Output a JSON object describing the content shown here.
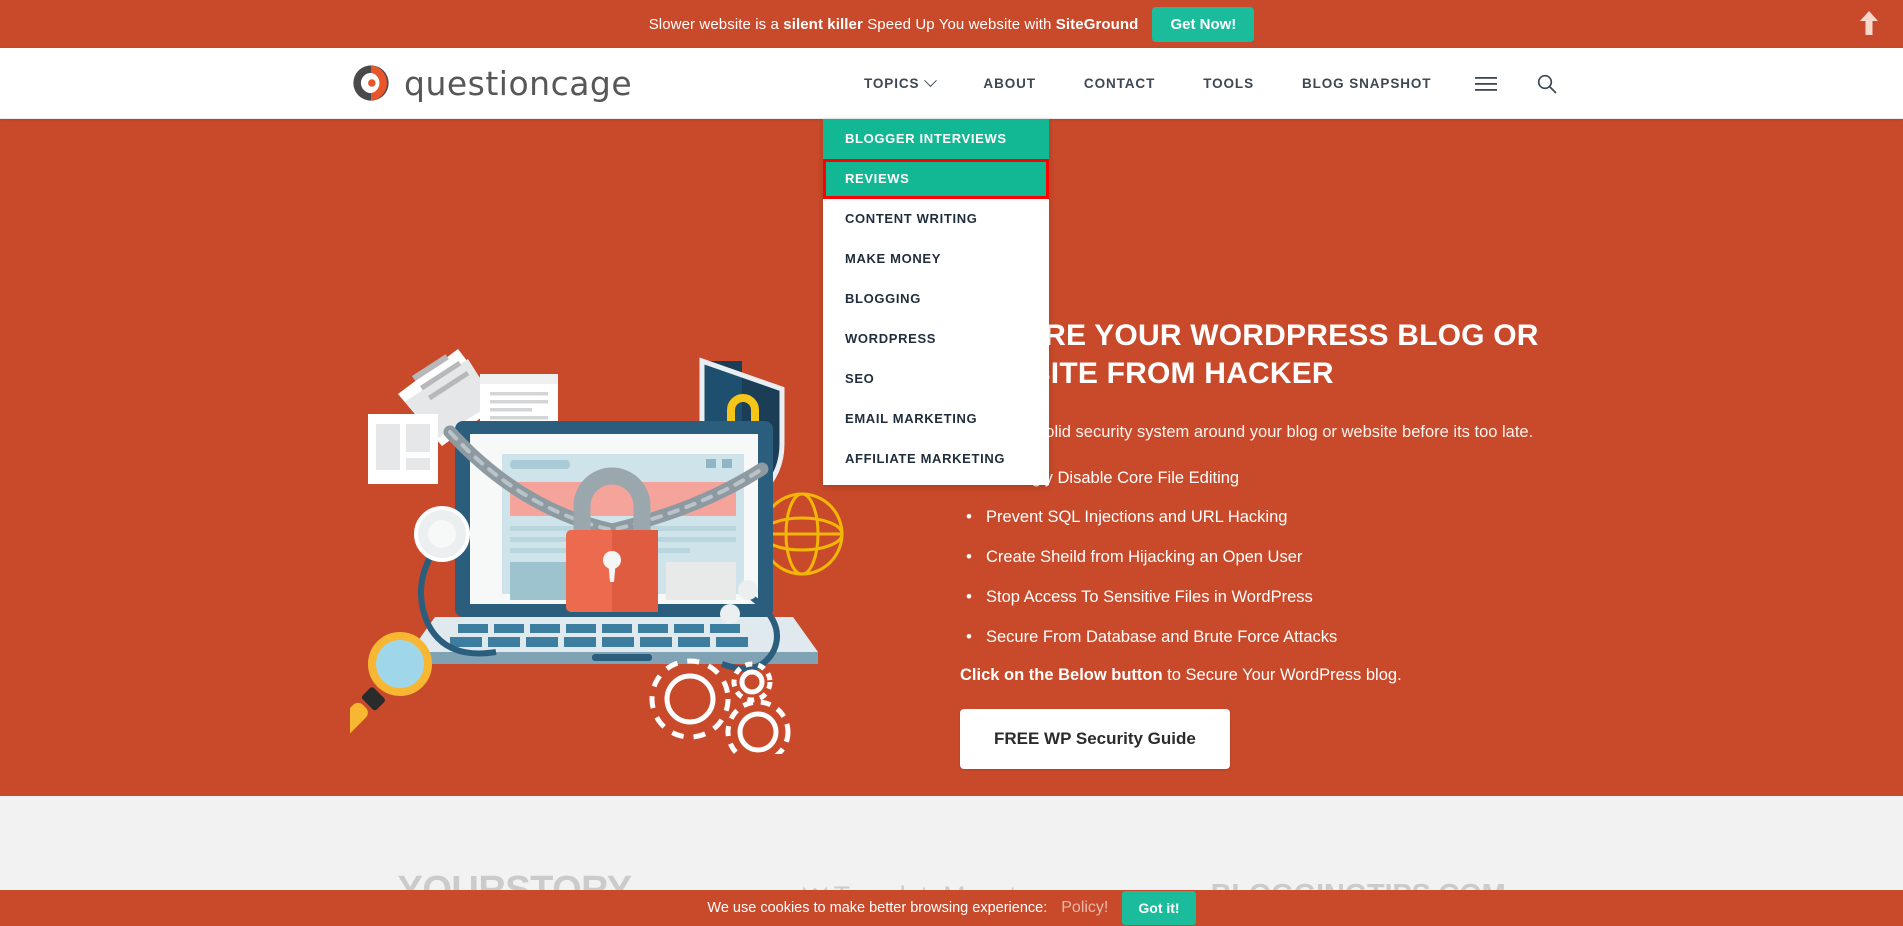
{
  "colors": {
    "brand_orange": "#c94a2a",
    "teal": "#1abc9c",
    "dropdown_active": "#12b794",
    "highlight_red": "#ff0000",
    "partner_gray": "#cbcbcb"
  },
  "promo": {
    "text_before": "Slower website is a ",
    "bold_1": "silent killer",
    "text_middle": " Speed Up You website with ",
    "bold_2": "SiteGround",
    "button_label": "Get Now!",
    "scroll_top_icon": "arrow-up-icon"
  },
  "header": {
    "logo_text": "questioncage",
    "logo_icon": "circle-logo-icon",
    "nav": [
      {
        "label": "TOPICS",
        "has_caret": true
      },
      {
        "label": "ABOUT",
        "has_caret": false
      },
      {
        "label": "CONTACT",
        "has_caret": false
      },
      {
        "label": "TOOLS",
        "has_caret": false
      },
      {
        "label": "BLOG SNAPSHOT",
        "has_caret": false
      }
    ],
    "hamburger_icon": "hamburger-menu-icon",
    "search_icon": "search-icon"
  },
  "dropdown": {
    "items": [
      {
        "label": "BLOGGER INTERVIEWS",
        "state": "active"
      },
      {
        "label": "REVIEWS",
        "state": "highlight"
      },
      {
        "label": "CONTENT WRITING",
        "state": "normal"
      },
      {
        "label": "MAKE MONEY",
        "state": "normal"
      },
      {
        "label": "BLOGGING",
        "state": "normal"
      },
      {
        "label": "WORDPRESS",
        "state": "normal"
      },
      {
        "label": "SEO",
        "state": "normal"
      },
      {
        "label": "EMAIL MARKETING",
        "state": "normal"
      },
      {
        "label": "AFFILIATE MARKETING",
        "state": "normal"
      }
    ]
  },
  "hero": {
    "title": "SECURE YOUR WORDPRESS BLOG OR WEBSITE FROM HACKER",
    "subtitle": "Build rock solid security system around your blog or website before its too late.",
    "bullets": [
      "Strikingly Disable Core File Editing",
      "Prevent SQL Injections and URL Hacking",
      "Create Sheild from Hijacking an Open User",
      "Stop Access To Sensitive Files in WordPress",
      "Secure From Database and Brute Force Attacks"
    ],
    "cta_bold": "Click on the Below button",
    "cta_rest": " to Secure Your WordPress blog.",
    "button_label": "FREE WP Security Guide",
    "illustration_icon": "laptop-chained-lock-illustration"
  },
  "partners": [
    {
      "name": "YOURSTORY",
      "icon": null
    },
    {
      "name": "TemplateMonster",
      "icon": "monster-icon"
    },
    {
      "name": "BLOGGINGTIPS.COM",
      "icon": null
    }
  ],
  "cookie": {
    "text": "We use cookies to make better browsing experience:",
    "link_label": "Policy!",
    "button_label": "Got it!"
  }
}
